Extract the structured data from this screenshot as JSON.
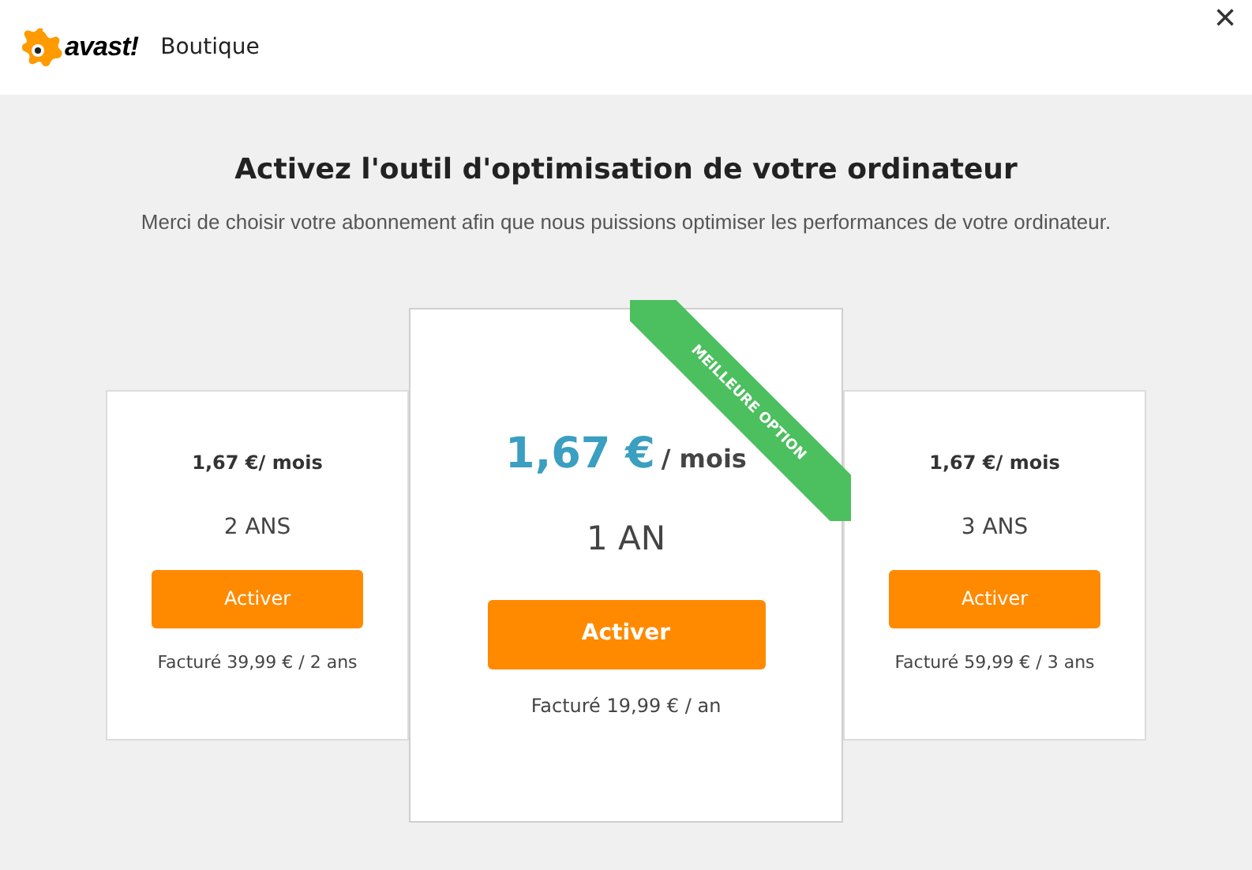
{
  "header": {
    "logo_text": "avast!",
    "title": "Boutique",
    "close": "×"
  },
  "heading": "Activez l'outil d'optimisation de votre ordinateur",
  "subheading": "Merci de choisir votre abonnement afin que nous puissions optimiser les performances de votre ordinateur.",
  "plans": [
    {
      "price": "1,67 €",
      "unit": "/ mois",
      "term": "2 ANS",
      "button": "Activer",
      "billing": "Facturé 39,99 € / 2 ans",
      "featured": false
    },
    {
      "price": "1,67 €",
      "unit": "/ mois",
      "term": "1 AN",
      "button": "Activer",
      "billing": "Facturé 19,99 € / an",
      "featured": true,
      "ribbon": "MEILLEURE OPTION"
    },
    {
      "price": "1,67 €",
      "unit": "/ mois",
      "term": "3 ANS",
      "button": "Activer",
      "billing": "Facturé 59,99 € / 3 ans",
      "featured": false
    }
  ]
}
